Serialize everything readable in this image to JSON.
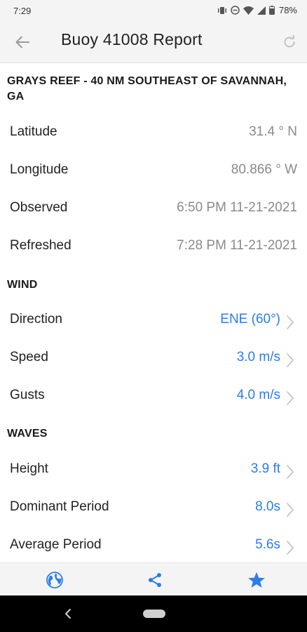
{
  "status_bar": {
    "time": "7:29",
    "battery": "78%"
  },
  "app_bar": {
    "title": "Buoy 41008 Report",
    "back_icon": "arrow-left-icon",
    "refresh_icon": "refresh-icon"
  },
  "station": {
    "name": "GRAYS REEF - 40 NM SOUTHEAST OF SAVANNAH, GA"
  },
  "info_rows": [
    {
      "label": "Latitude",
      "value": "31.4 ° N"
    },
    {
      "label": "Longitude",
      "value": "80.866 ° W"
    },
    {
      "label": "Observed",
      "value": "6:50 PM 11-21-2021"
    },
    {
      "label": "Refreshed",
      "value": "7:28 PM 11-21-2021"
    }
  ],
  "wind": {
    "header": "WIND",
    "rows": [
      {
        "label": "Direction",
        "value": "ENE (60°)"
      },
      {
        "label": "Speed",
        "value": "3.0 m/s"
      },
      {
        "label": "Gusts",
        "value": "4.0 m/s"
      }
    ]
  },
  "waves": {
    "header": "WAVES",
    "rows": [
      {
        "label": "Height",
        "value": "3.9 ft"
      },
      {
        "label": "Dominant Period",
        "value": "8.0s"
      },
      {
        "label": "Average Period",
        "value": "5.6s"
      }
    ]
  },
  "bottom_bar": {
    "icons": [
      "globe-icon",
      "share-icon",
      "star-icon"
    ]
  },
  "colors": {
    "accent": "#2b7de9",
    "value_gray": "#8a8a8a",
    "bar_background": "#f4f4f4"
  }
}
